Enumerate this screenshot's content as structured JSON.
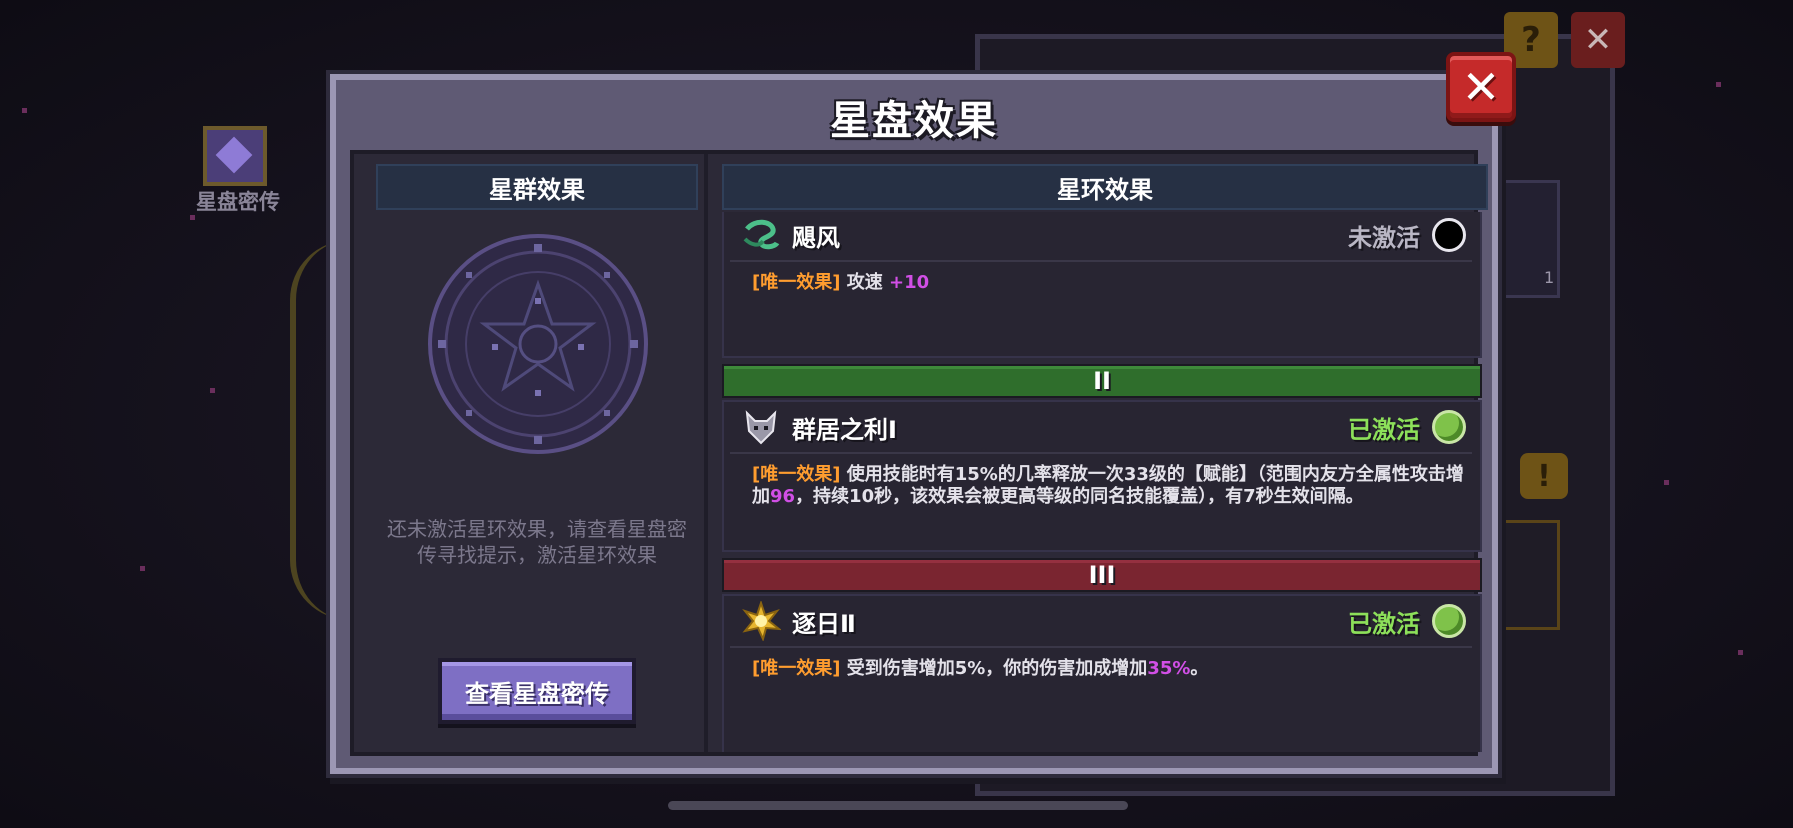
{
  "background": {
    "relic_label": "星盘密传",
    "help_glyph": "?",
    "close_glyph": "✕",
    "card_count": "1",
    "warn_glyph": "!"
  },
  "dialog": {
    "title": "星盘效果",
    "close_glyph": "✕",
    "left": {
      "header": "星群效果",
      "hint": "还未激活星环效果，请查看星盘密传寻找提示，激活星环效果",
      "button": "查看星盘密传"
    },
    "right": {
      "header": "星环效果",
      "rows": [
        {
          "name": "飓风",
          "status": "未激活",
          "active": false,
          "tag": "[唯一效果]",
          "desc_parts": [
            "攻速 ",
            "+10",
            ""
          ]
        },
        {
          "tier": "II",
          "name": "群居之利Ⅰ",
          "status": "已激活",
          "active": true,
          "tag": "[唯一效果]",
          "desc_parts": [
            "使用技能时有15%的几率释放一次33级的【赋能】（范围内友方全属性攻击增加",
            "96",
            "，持续10秒，该效果会被更高等级的同名技能覆盖），有7秒生效间隔。"
          ]
        },
        {
          "tier": "III",
          "name": "逐日Ⅱ",
          "status": "已激活",
          "active": true,
          "tag": "[唯一效果]",
          "desc_parts": [
            "受到伤害增加5%，你的伤害加成增加",
            "35%",
            "。"
          ]
        }
      ]
    }
  },
  "colors": {
    "tag": "#ff9d2f",
    "value": "#d14fe6",
    "active": "#8de05a",
    "inactive": "#b9b6c4",
    "tier_green": "#2f6e2c",
    "tier_red": "#7a2530"
  }
}
